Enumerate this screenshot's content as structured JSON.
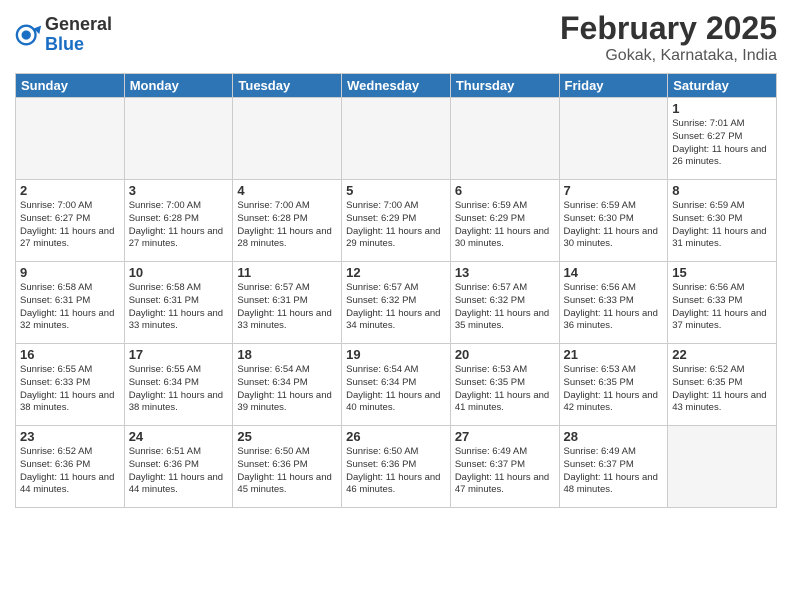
{
  "header": {
    "logo_general": "General",
    "logo_blue": "Blue",
    "month_year": "February 2025",
    "location": "Gokak, Karnataka, India"
  },
  "weekdays": [
    "Sunday",
    "Monday",
    "Tuesday",
    "Wednesday",
    "Thursday",
    "Friday",
    "Saturday"
  ],
  "weeks": [
    [
      {
        "day": "",
        "info": ""
      },
      {
        "day": "",
        "info": ""
      },
      {
        "day": "",
        "info": ""
      },
      {
        "day": "",
        "info": ""
      },
      {
        "day": "",
        "info": ""
      },
      {
        "day": "",
        "info": ""
      },
      {
        "day": "1",
        "info": "Sunrise: 7:01 AM\nSunset: 6:27 PM\nDaylight: 11 hours\nand 26 minutes."
      }
    ],
    [
      {
        "day": "2",
        "info": "Sunrise: 7:00 AM\nSunset: 6:27 PM\nDaylight: 11 hours\nand 27 minutes."
      },
      {
        "day": "3",
        "info": "Sunrise: 7:00 AM\nSunset: 6:28 PM\nDaylight: 11 hours\nand 27 minutes."
      },
      {
        "day": "4",
        "info": "Sunrise: 7:00 AM\nSunset: 6:28 PM\nDaylight: 11 hours\nand 28 minutes."
      },
      {
        "day": "5",
        "info": "Sunrise: 7:00 AM\nSunset: 6:29 PM\nDaylight: 11 hours\nand 29 minutes."
      },
      {
        "day": "6",
        "info": "Sunrise: 6:59 AM\nSunset: 6:29 PM\nDaylight: 11 hours\nand 30 minutes."
      },
      {
        "day": "7",
        "info": "Sunrise: 6:59 AM\nSunset: 6:30 PM\nDaylight: 11 hours\nand 30 minutes."
      },
      {
        "day": "8",
        "info": "Sunrise: 6:59 AM\nSunset: 6:30 PM\nDaylight: 11 hours\nand 31 minutes."
      }
    ],
    [
      {
        "day": "9",
        "info": "Sunrise: 6:58 AM\nSunset: 6:31 PM\nDaylight: 11 hours\nand 32 minutes."
      },
      {
        "day": "10",
        "info": "Sunrise: 6:58 AM\nSunset: 6:31 PM\nDaylight: 11 hours\nand 33 minutes."
      },
      {
        "day": "11",
        "info": "Sunrise: 6:57 AM\nSunset: 6:31 PM\nDaylight: 11 hours\nand 33 minutes."
      },
      {
        "day": "12",
        "info": "Sunrise: 6:57 AM\nSunset: 6:32 PM\nDaylight: 11 hours\nand 34 minutes."
      },
      {
        "day": "13",
        "info": "Sunrise: 6:57 AM\nSunset: 6:32 PM\nDaylight: 11 hours\nand 35 minutes."
      },
      {
        "day": "14",
        "info": "Sunrise: 6:56 AM\nSunset: 6:33 PM\nDaylight: 11 hours\nand 36 minutes."
      },
      {
        "day": "15",
        "info": "Sunrise: 6:56 AM\nSunset: 6:33 PM\nDaylight: 11 hours\nand 37 minutes."
      }
    ],
    [
      {
        "day": "16",
        "info": "Sunrise: 6:55 AM\nSunset: 6:33 PM\nDaylight: 11 hours\nand 38 minutes."
      },
      {
        "day": "17",
        "info": "Sunrise: 6:55 AM\nSunset: 6:34 PM\nDaylight: 11 hours\nand 38 minutes."
      },
      {
        "day": "18",
        "info": "Sunrise: 6:54 AM\nSunset: 6:34 PM\nDaylight: 11 hours\nand 39 minutes."
      },
      {
        "day": "19",
        "info": "Sunrise: 6:54 AM\nSunset: 6:34 PM\nDaylight: 11 hours\nand 40 minutes."
      },
      {
        "day": "20",
        "info": "Sunrise: 6:53 AM\nSunset: 6:35 PM\nDaylight: 11 hours\nand 41 minutes."
      },
      {
        "day": "21",
        "info": "Sunrise: 6:53 AM\nSunset: 6:35 PM\nDaylight: 11 hours\nand 42 minutes."
      },
      {
        "day": "22",
        "info": "Sunrise: 6:52 AM\nSunset: 6:35 PM\nDaylight: 11 hours\nand 43 minutes."
      }
    ],
    [
      {
        "day": "23",
        "info": "Sunrise: 6:52 AM\nSunset: 6:36 PM\nDaylight: 11 hours\nand 44 minutes."
      },
      {
        "day": "24",
        "info": "Sunrise: 6:51 AM\nSunset: 6:36 PM\nDaylight: 11 hours\nand 44 minutes."
      },
      {
        "day": "25",
        "info": "Sunrise: 6:50 AM\nSunset: 6:36 PM\nDaylight: 11 hours\nand 45 minutes."
      },
      {
        "day": "26",
        "info": "Sunrise: 6:50 AM\nSunset: 6:36 PM\nDaylight: 11 hours\nand 46 minutes."
      },
      {
        "day": "27",
        "info": "Sunrise: 6:49 AM\nSunset: 6:37 PM\nDaylight: 11 hours\nand 47 minutes."
      },
      {
        "day": "28",
        "info": "Sunrise: 6:49 AM\nSunset: 6:37 PM\nDaylight: 11 hours\nand 48 minutes."
      },
      {
        "day": "",
        "info": ""
      }
    ]
  ]
}
